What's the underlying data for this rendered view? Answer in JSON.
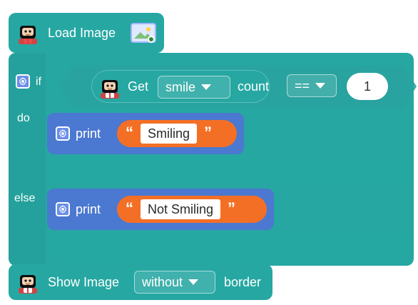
{
  "blocks": {
    "load_image": {
      "label": "Load Image"
    },
    "if_block": {
      "if_label": "if",
      "do_label": "do",
      "else_label": "else",
      "condition": {
        "get_label": "Get",
        "metric_selected": "smile",
        "count_label": "count",
        "operator_selected": "==",
        "value": "1"
      }
    },
    "print_true": {
      "label": "print",
      "text": "Smiling"
    },
    "print_false": {
      "label": "print",
      "text": "Not Smiling"
    },
    "show_image": {
      "label": "Show Image",
      "border_option_selected": "without",
      "border_label": "border"
    }
  },
  "icons": {
    "robot": "robot-head-icon",
    "image": "image-icon",
    "gear": "gear-icon",
    "dropdown": "chevron-down-icon",
    "quote_open": "“",
    "quote_close": "”"
  },
  "colors": {
    "teal": "#26a7a2",
    "teal_dark": "#1f8f8a",
    "blue": "#4b78d0",
    "orange": "#f46f26",
    "white": "#ffffff"
  }
}
